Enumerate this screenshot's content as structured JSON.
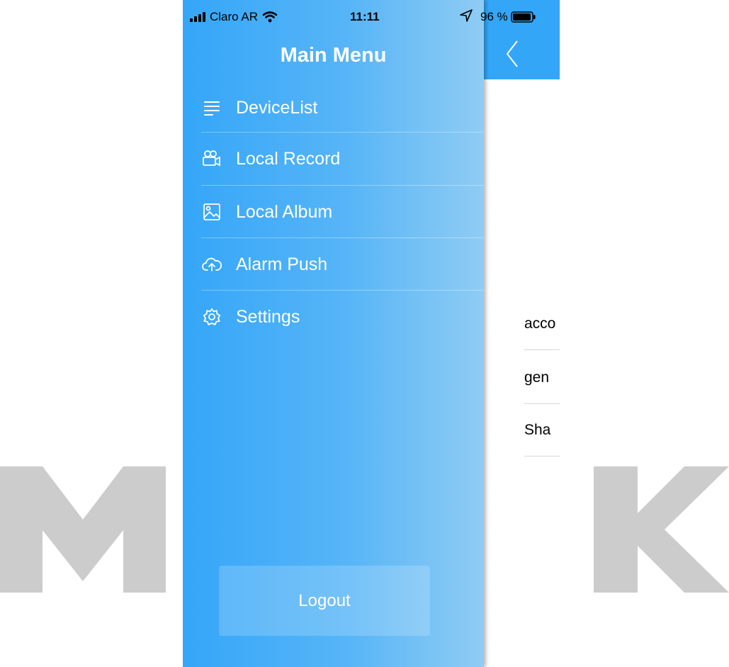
{
  "status_bar": {
    "carrier": "Claro AR",
    "time": "11:11",
    "battery": "96 %"
  },
  "drawer": {
    "title": "Main Menu",
    "items": [
      {
        "label": "DeviceList",
        "icon": "list-icon"
      },
      {
        "label": "Local Record",
        "icon": "video-camera-icon"
      },
      {
        "label": "Local Album",
        "icon": "image-icon"
      },
      {
        "label": "Alarm Push",
        "icon": "cloud-upload-icon"
      },
      {
        "label": "Settings",
        "icon": "gear-icon"
      }
    ],
    "logout_label": "Logout"
  },
  "background_list": {
    "items": [
      "acco",
      "gen",
      "Sha"
    ]
  },
  "watermark": {
    "letters": [
      "M",
      "K"
    ]
  },
  "colors": {
    "drawer_start": "#35a6f8",
    "drawer_end": "#8fccf4",
    "nav_bar": "#33a6f8",
    "watermark": "#cccccc"
  }
}
